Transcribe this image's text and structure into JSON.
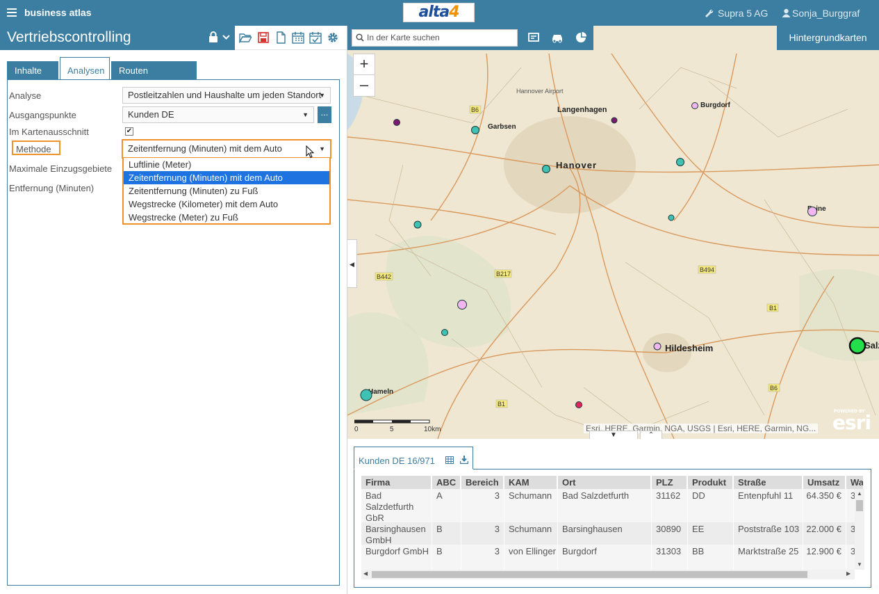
{
  "app": {
    "title": "business atlas",
    "company": "Supra 5 AG",
    "user": "Sonja_Burggraf"
  },
  "logo": {
    "text_main": "alta",
    "text_accent": "4"
  },
  "panel": {
    "title": "Vertriebscontrolling",
    "tabs": [
      "Inhalte",
      "Analysen",
      "Routen berechnen"
    ],
    "active_tab": "Analysen"
  },
  "form": {
    "analyse_label": "Analyse",
    "analyse_value": "Postleitzahlen und Haushalte um jeden Standort",
    "ausgangspunkte_label": "Ausgangspunkte",
    "ausgangspunkte_value": "Kunden DE",
    "ausgangspunkte_btn": "...",
    "kartenausschnitt_label": "Im Kartenausschnitt",
    "methode_label": "Methode",
    "methode_value": "Zeitentfernung (Minuten) mit dem Auto",
    "max_label": "Maximale Einzugsgebiete",
    "entfernung_label": "Entfernung (Minuten)",
    "methode_options": [
      "Luftlinie (Meter)",
      "Zeitentfernung (Minuten) mit dem Auto",
      "Zeitentfernung (Minuten) zu Fuß",
      "Wegstrecke (Kilometer) mit dem Auto",
      "Wegstrecke (Meter) zu Fuß"
    ],
    "methode_selected_index": 1
  },
  "map": {
    "search_placeholder": "In der Karte suchen",
    "basemap_label": "Hintergrundkarten",
    "zoom_in": "+",
    "zoom_out": "–",
    "attribution": "Esri, HERE, Garmin, NGA, USGS | Esri, HERE, Garmin, NG...",
    "esri_text": "esri",
    "esri_powered": "POWERED BY",
    "scale_labels": [
      "0",
      "5",
      "10km"
    ],
    "place_labels": [
      "Hannover Airport",
      "Langenhagen",
      "Burgdorf",
      "Garbsen",
      "Hanover",
      "Peine",
      "Hildesheim",
      "Hameln",
      "Salz"
    ],
    "road_labels": [
      "B6",
      "B217",
      "B442",
      "B494",
      "B1",
      "B6",
      "B1"
    ]
  },
  "table": {
    "tab_label": "Kunden DE 16/971",
    "columns": [
      "Firma",
      "ABC",
      "Bereich",
      "KAM",
      "Ort",
      "PLZ",
      "Produkt",
      "Straße",
      "Umsatz",
      "War"
    ],
    "rows": [
      [
        "Bad Salzdetfurth GbR",
        "A",
        "3",
        "Schumann",
        "Bad Salzdetfurth",
        "31162",
        "DD",
        "Entenpfuhl 11",
        "64.350 €",
        "3"
      ],
      [
        "Barsinghausen GmbH",
        "B",
        "3",
        "Schumann",
        "Barsinghausen",
        "30890",
        "EE",
        "Poststraße 103",
        "22.000 €",
        "3"
      ],
      [
        "Burgdorf GmbH",
        "B",
        "3",
        "von Ellinger",
        "Burgdorf",
        "31303",
        "BB",
        "Marktstraße 25",
        "12.900 €",
        "3"
      ]
    ]
  },
  "colors": {
    "primary": "#3b7ea1",
    "highlight": "#f0922c",
    "selection": "#1e73e0"
  }
}
